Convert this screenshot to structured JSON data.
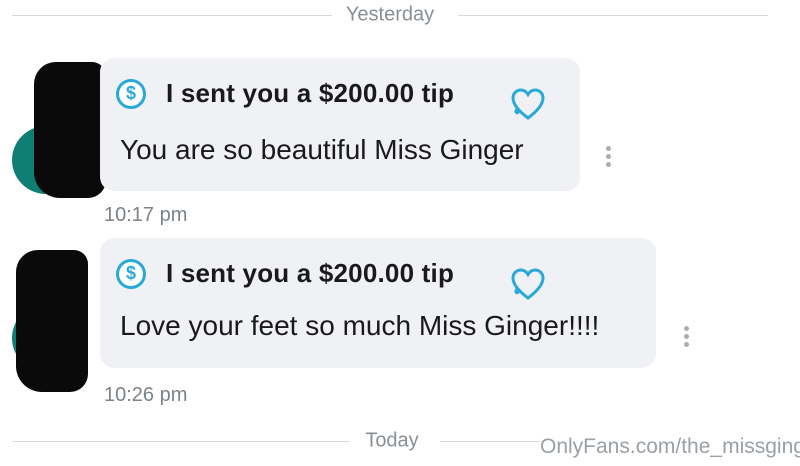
{
  "dividers": {
    "top": "Yesterday",
    "bottom": "Today"
  },
  "messages": [
    {
      "tip_label": "I sent you a $200.00 tip",
      "text": "You are so beautiful Miss Ginger",
      "time": "10:17 pm"
    },
    {
      "tip_label": "I sent you a $200.00 tip",
      "text": "Love your feet so much Miss Ginger!!!!",
      "time": "10:26 pm"
    }
  ],
  "icons": {
    "tip": "dollar-circle-icon",
    "like": "heart-icon",
    "more": "vertical-dots-icon",
    "dollar_glyph": "$"
  },
  "colors": {
    "accent": "#2aa8d8",
    "bubble": "#eff1f5",
    "avatar": "#0e7f72"
  },
  "watermark": "OnlyFans.com/the_missginger"
}
